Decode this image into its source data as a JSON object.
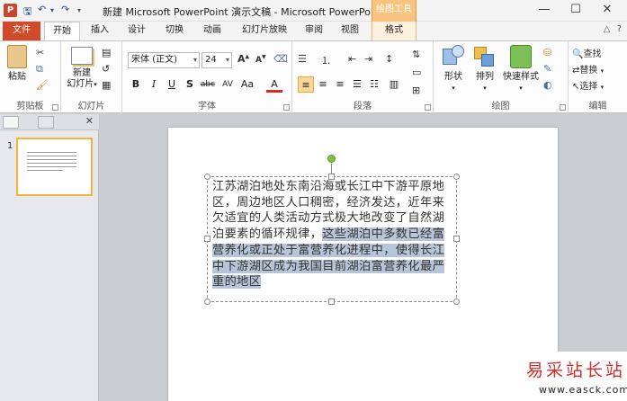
{
  "window": {
    "title": "新建 Microsoft PowerPoint 演示文稿 - Microsoft PowerPoint",
    "context_tab_title": "绘图工具",
    "app_icon": "P",
    "controls": {
      "minimize": "—",
      "maximize": "☐",
      "close": "✕"
    }
  },
  "quick_access": {
    "save_icon": "save-icon",
    "undo_icon": "undo-icon",
    "redo_icon": "redo-icon"
  },
  "tabs": [
    {
      "label": "文件"
    },
    {
      "label": "开始"
    },
    {
      "label": "插入"
    },
    {
      "label": "设计"
    },
    {
      "label": "切换"
    },
    {
      "label": "动画"
    },
    {
      "label": "幻灯片放映"
    },
    {
      "label": "审阅"
    },
    {
      "label": "视图"
    },
    {
      "label": "格式"
    }
  ],
  "ribbon": {
    "clipboard": {
      "label": "剪贴板",
      "paste": "粘贴"
    },
    "slides": {
      "label": "幻灯片",
      "new_slide_1": "新建",
      "new_slide_2": "幻灯片"
    },
    "font": {
      "label": "字体",
      "family": "宋体 (正文)",
      "size": "24",
      "bold": "B",
      "italic": "I",
      "underline": "U",
      "shadow": "S",
      "strike": "abc",
      "spacing": "AV",
      "case": "Aa",
      "color": "A"
    },
    "paragraph": {
      "label": "段落"
    },
    "drawing": {
      "label": "绘图",
      "shapes": "形状",
      "arrange": "排列",
      "quick_styles": "快速样式"
    },
    "editing": {
      "label": "编辑",
      "find": "查找",
      "replace": "替换",
      "select": "选择"
    }
  },
  "slides_panel": {
    "slide_number": "1"
  },
  "slide": {
    "text_normal": "江苏湖泊地处东南沿海或长江中下游平原地区，周边地区人口稠密，经济发达，近年来欠适宜的人类活动方式极大地改变了自然湖泊要素的循环规律，",
    "text_selected": "这些湖泊中多数已经富营养化或正处于富营养化进程中，使得长江中下游湖区成为我国目前湖泊富营养化最严重的地区"
  },
  "watermark": {
    "title": "易采站长站",
    "url": "www.easck.com"
  },
  "colors": {
    "file_tab": "#cf4a27",
    "context_tab": "#f7c37e",
    "selection": "#b8c4d8",
    "rotate_handle": "#7ac142",
    "watermark": "#d42b2b"
  }
}
